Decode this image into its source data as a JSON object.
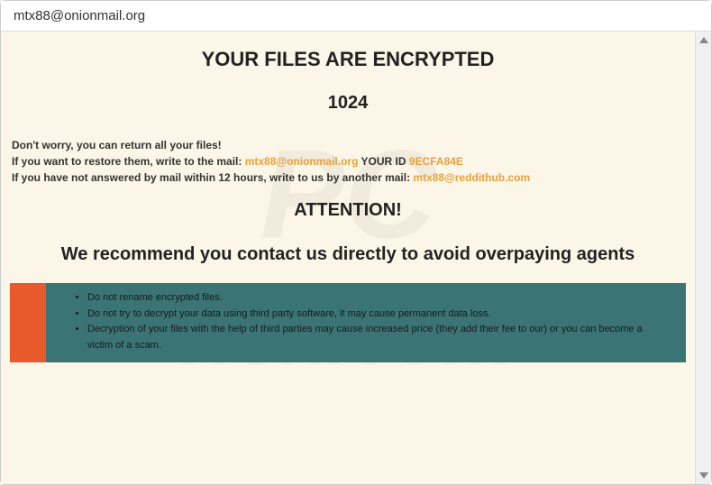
{
  "titlebar": {
    "title": "mtx88@onionmail.org"
  },
  "main": {
    "heading": "YOUR FILES ARE ENCRYPTED",
    "number": "1024",
    "line1": "Don't worry, you can return all your files!",
    "line2_prefix": "If you want to restore them, write to the mail:   ",
    "line2_email": "mtx88@onionmail.org",
    "line2_yourid_label": "   YOUR ID ",
    "line2_yourid": "9ECFA84E",
    "line3_prefix": "If you have not answered by mail within 12 hours, write to us by another mail:  ",
    "line3_email": "mtx88@reddithub.com",
    "attention": "ATTENTION!",
    "recommend": "We recommend you contact us directly to avoid overpaying agents",
    "warnings": [
      "Do not rename encrypted files.",
      "Do not try to decrypt your data using third party software, it may cause permanent data loss.",
      "Decryption of your files with the help of third parties may cause increased price (they add their fee to our) or you can become a victim of a scam."
    ]
  }
}
